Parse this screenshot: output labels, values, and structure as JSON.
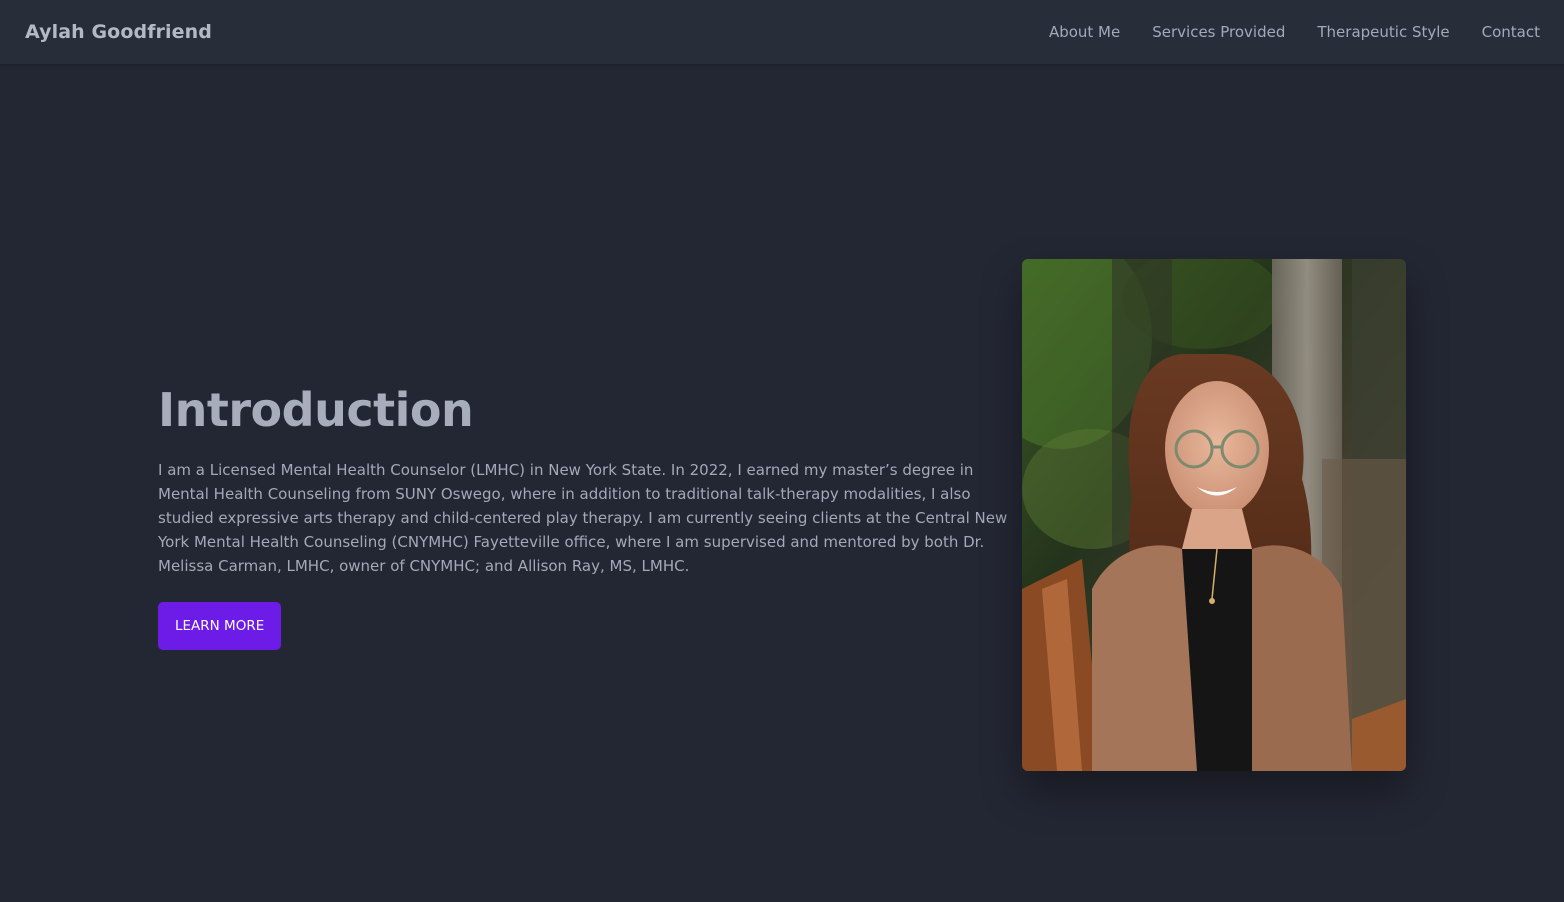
{
  "header": {
    "brand": "Aylah Goodfriend",
    "nav": [
      {
        "label": "About Me"
      },
      {
        "label": "Services Provided"
      },
      {
        "label": "Therapeutic Style"
      },
      {
        "label": "Contact"
      }
    ]
  },
  "hero": {
    "title": "Introduction",
    "body": "I am a Licensed Mental Health Counselor (LMHC) in New York State. In 2022, I earned my master’s degree in Mental Health Counseling from SUNY Oswego, where in addition to traditional talk-therapy modalities, I also studied expressive arts therapy and child-centered play therapy. I am currently seeing clients at the Central New York Mental Health Counseling (CNYMHC) Fayetteville office, where I am supervised and mentored by both Dr. Melissa Carman, LMHC, owner of CNYMHC; and Allison Ray, MS, LMHC.",
    "button_label": "LEARN MORE"
  },
  "colors": {
    "background": "#232733",
    "navbar": "#282d3a",
    "accent": "#6d1be6"
  }
}
